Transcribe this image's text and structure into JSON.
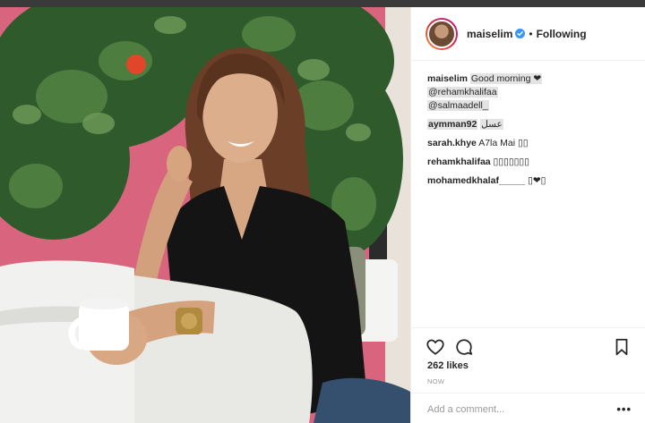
{
  "post": {
    "photo_alt": "Woman in black lace top seated on white sofa holding a mug, plants and pink wall behind",
    "header": {
      "username": "maiselim",
      "verified": true,
      "separator": "•",
      "follow_label": "Following"
    },
    "caption": {
      "username": "maiselim",
      "text": "Good morning ❤",
      "mentions": [
        "@rehamkhalifaa",
        "@salmaadell_"
      ]
    },
    "comments": [
      {
        "username": "aymman92",
        "text": "عسل"
      },
      {
        "username": "sarah.khye",
        "text": "A7la Mai ▯▯"
      },
      {
        "username": "rehamkhalifaa",
        "text": "▯▯▯▯▯▯▯"
      },
      {
        "username": "mohamedkhalaf_____",
        "text": "▯❤▯"
      }
    ],
    "likes_text": "262 likes",
    "timestamp": "NOW",
    "add_comment_placeholder": "Add a comment...",
    "more_label": "•••"
  },
  "icons": {
    "like": "heart-icon",
    "comment": "comment-bubble-icon",
    "save": "bookmark-icon",
    "verified": "verified-badge-icon",
    "more": "more-options-icon"
  },
  "colors": {
    "verified_blue": "#3897f0",
    "wall_pink": "#d9647e",
    "border": "#efefef",
    "muted_text": "#999999"
  }
}
